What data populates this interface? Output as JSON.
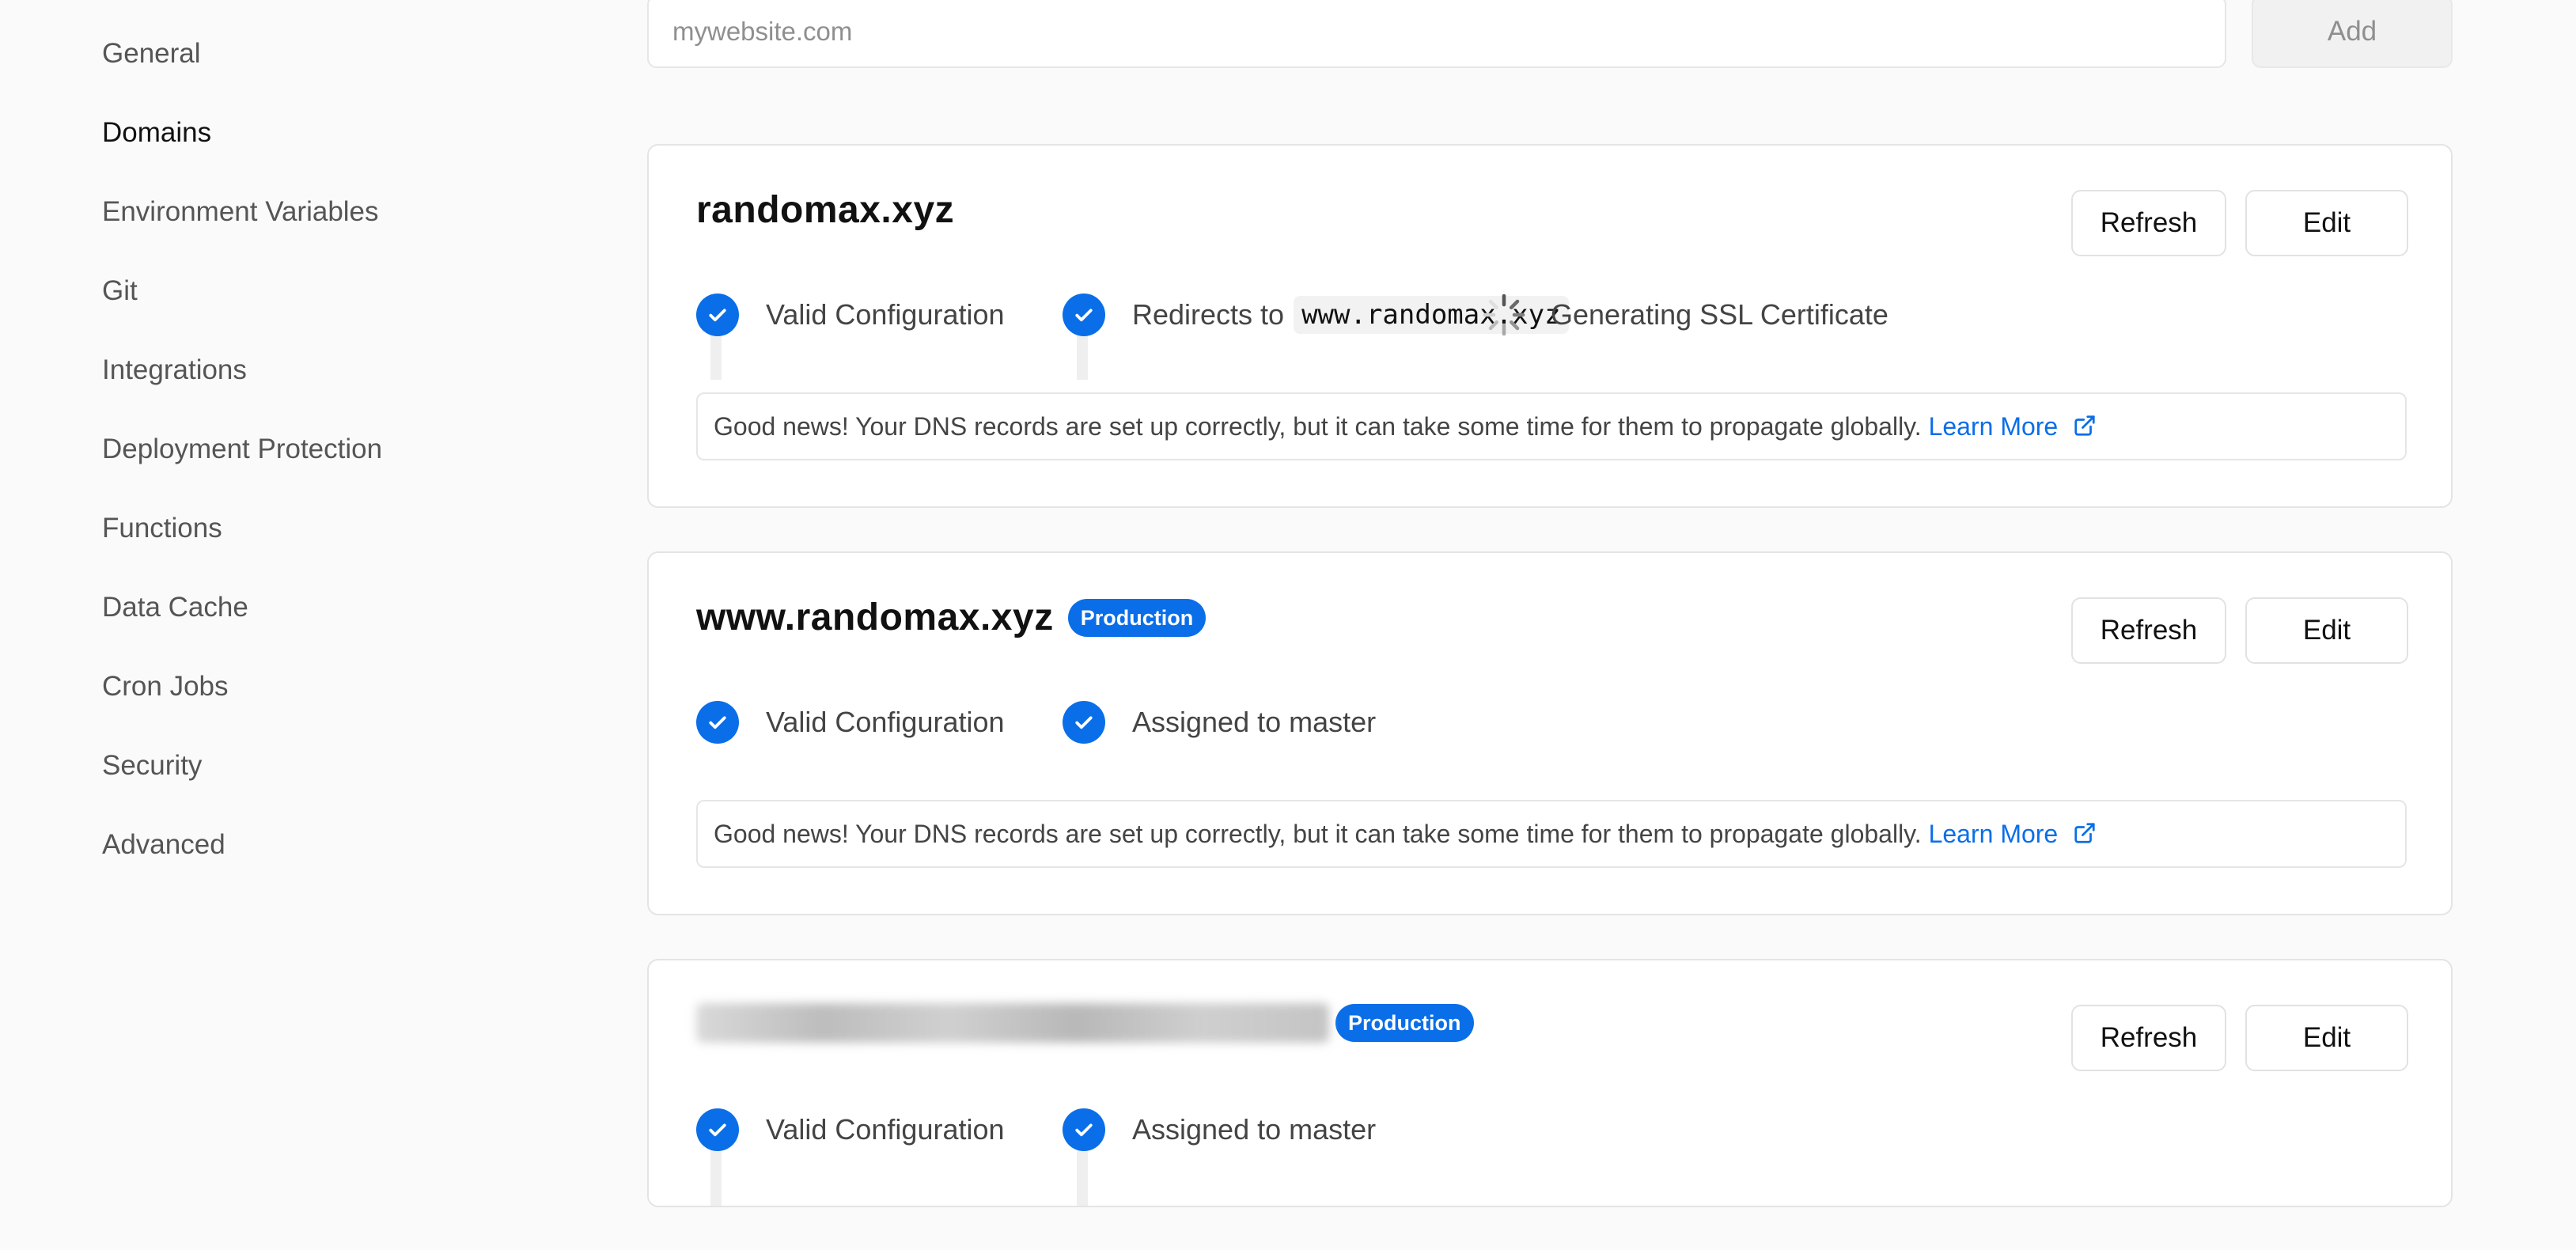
{
  "sidebar": {
    "items": [
      {
        "label": "General"
      },
      {
        "label": "Domains"
      },
      {
        "label": "Environment Variables"
      },
      {
        "label": "Git"
      },
      {
        "label": "Integrations"
      },
      {
        "label": "Deployment Protection"
      },
      {
        "label": "Functions"
      },
      {
        "label": "Data Cache"
      },
      {
        "label": "Cron Jobs"
      },
      {
        "label": "Security"
      },
      {
        "label": "Advanced"
      }
    ],
    "active": "Domains"
  },
  "add_domain": {
    "placeholder": "mywebsite.com",
    "add_label": "Add"
  },
  "domains": [
    {
      "name": "randomax.xyz",
      "refresh_label": "Refresh",
      "edit_label": "Edit",
      "statuses": {
        "valid": "Valid Configuration",
        "redirect_prefix": "Redirects to",
        "redirect_target": "www.randomax.xyz",
        "ssl": "Generating SSL Certificate"
      },
      "notice": "Good news! Your DNS records are set up correctly, but it can take some time for them to propagate globally.",
      "learn_more": "Learn More"
    },
    {
      "name": "www.randomax.xyz",
      "badge": "Production",
      "refresh_label": "Refresh",
      "edit_label": "Edit",
      "statuses": {
        "valid": "Valid Configuration",
        "assigned": "Assigned to master"
      },
      "notice": "Good news! Your DNS records are set up correctly, but it can take some time for them to propagate globally.",
      "learn_more": "Learn More"
    },
    {
      "badge": "Production",
      "refresh_label": "Refresh",
      "edit_label": "Edit",
      "statuses": {
        "valid": "Valid Configuration",
        "assigned": "Assigned to master"
      }
    }
  ],
  "colors": {
    "accent": "#0a6ee8",
    "background": "#fafafa"
  }
}
